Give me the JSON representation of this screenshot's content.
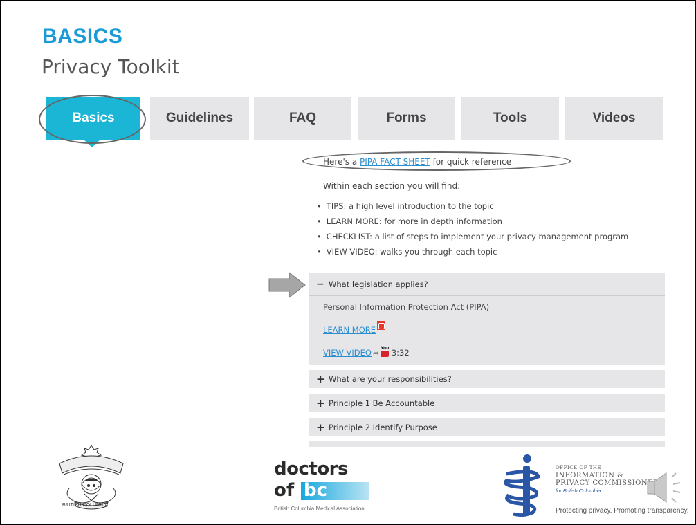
{
  "header": {
    "title": "BASICS",
    "subtitle": "Privacy Toolkit"
  },
  "tabs": [
    {
      "label": "Basics",
      "active": true
    },
    {
      "label": "Guidelines",
      "active": false
    },
    {
      "label": "FAQ",
      "active": false
    },
    {
      "label": "Forms",
      "active": false
    },
    {
      "label": "Tools",
      "active": false
    },
    {
      "label": "Videos",
      "active": false
    }
  ],
  "content": {
    "fact_prefix": "Here's a ",
    "fact_link": "PIPA FACT SHEET",
    "fact_suffix": " for quick reference",
    "intro": "Within each section you will find:",
    "bullets": [
      "TIPS: a high level introduction to the topic",
      "LEARN MORE: for more in depth information",
      "CHECKLIST: a list of steps to implement your privacy management program",
      "VIEW VIDEO: walks you through each topic"
    ]
  },
  "accordion": {
    "open_item": {
      "sign": "−",
      "title": "What legislation applies?",
      "body": "Personal Information Protection Act (PIPA)",
      "learn_more": "LEARN MORE",
      "view_video": "VIEW VIDEO",
      "video_duration": "3:32"
    },
    "closed_items": [
      {
        "sign": "+",
        "title": "What are your responsibilities?"
      },
      {
        "sign": "+",
        "title": "Principle 1 Be Accountable"
      },
      {
        "sign": "+",
        "title": "Principle 2 Identify Purpose"
      }
    ]
  },
  "footer": {
    "cps_caption": "BRITISH COLUMBIA",
    "doctors_word": "doctors",
    "doctors_of": "of",
    "doctors_bc": "bc",
    "doctors_caption": "British Columbia Medical Association",
    "oipc_line1": "OFFICE OF THE",
    "oipc_line2": "INFORMATION &",
    "oipc_line3": "PRIVACY COMMISSIONER",
    "oipc_line4": "for British Columbia",
    "oipc_tagline": "Protecting privacy. Promoting transparency."
  },
  "colors": {
    "accent": "#1a9bd7",
    "active_tab": "#1bb5d6",
    "tab_bg": "#e6e6e9",
    "link": "#2a8fd0"
  },
  "icons": [
    "arrow-right-icon",
    "pdf-icon",
    "share-arrow-icon",
    "youtube-icon",
    "speaker-icon",
    "cpsbc-crest-icon",
    "oipc-emblem-icon"
  ]
}
